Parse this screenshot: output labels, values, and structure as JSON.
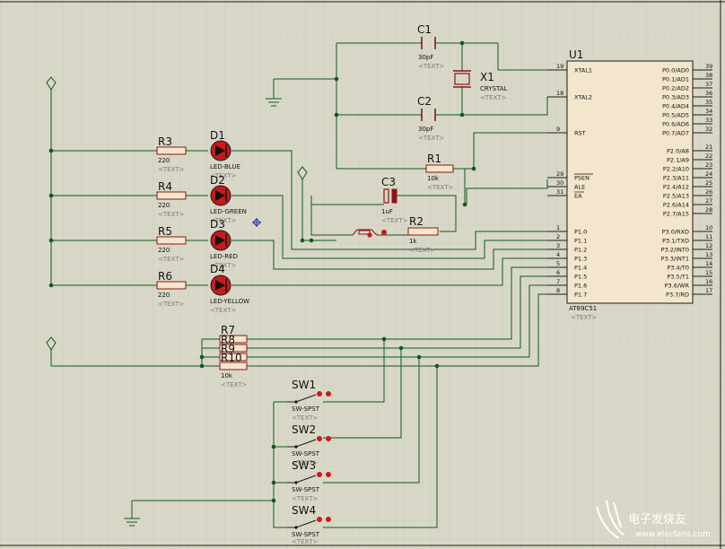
{
  "components": {
    "U1": {
      "ref": "U1",
      "part": "AT89C51",
      "text": "<TEXT>",
      "left_pins": [
        {
          "num": "19",
          "name": "XTAL1"
        },
        {
          "num": "18",
          "name": "XTAL2"
        },
        {
          "num": "9",
          "name": "RST"
        },
        {
          "num": "29",
          "name": "PSEN"
        },
        {
          "num": "30",
          "name": "ALE"
        },
        {
          "num": "31",
          "name": "EA"
        },
        {
          "num": "1",
          "name": "P1.0"
        },
        {
          "num": "2",
          "name": "P1.1"
        },
        {
          "num": "3",
          "name": "P1.2"
        },
        {
          "num": "4",
          "name": "P1.3"
        },
        {
          "num": "5",
          "name": "P1.4"
        },
        {
          "num": "6",
          "name": "P1.5"
        },
        {
          "num": "7",
          "name": "P1.6"
        },
        {
          "num": "8",
          "name": "P1.7"
        }
      ],
      "right_pins": [
        {
          "num": "39",
          "name": "P0.0/AD0"
        },
        {
          "num": "38",
          "name": "P0.1/AD1"
        },
        {
          "num": "37",
          "name": "P0.2/AD2"
        },
        {
          "num": "36",
          "name": "P0.3/AD3"
        },
        {
          "num": "35",
          "name": "P0.4/AD4"
        },
        {
          "num": "34",
          "name": "P0.5/AD5"
        },
        {
          "num": "33",
          "name": "P0.6/AD6"
        },
        {
          "num": "32",
          "name": "P0.7/AD7"
        },
        {
          "num": "21",
          "name": "P2.0/A8"
        },
        {
          "num": "22",
          "name": "P2.1/A9"
        },
        {
          "num": "23",
          "name": "P2.2/A10"
        },
        {
          "num": "24",
          "name": "P2.3/A11"
        },
        {
          "num": "25",
          "name": "P2.4/A12"
        },
        {
          "num": "26",
          "name": "P2.5/A13"
        },
        {
          "num": "27",
          "name": "P2.6/A14"
        },
        {
          "num": "28",
          "name": "P2.7/A15"
        },
        {
          "num": "10",
          "name": "P3.0/RXD"
        },
        {
          "num": "11",
          "name": "P3.1/TXD"
        },
        {
          "num": "12",
          "name": "P3.2/INT0"
        },
        {
          "num": "13",
          "name": "P3.3/INT1"
        },
        {
          "num": "14",
          "name": "P3.4/T0"
        },
        {
          "num": "15",
          "name": "P3.5/T1"
        },
        {
          "num": "16",
          "name": "P3.6/WR"
        },
        {
          "num": "17",
          "name": "P3.7/RD"
        }
      ]
    },
    "C1": {
      "ref": "C1",
      "value": "30pF",
      "text": "<TEXT>"
    },
    "C2": {
      "ref": "C2",
      "value": "30pF",
      "text": "<TEXT>"
    },
    "C3": {
      "ref": "C3",
      "value": "1uF",
      "text": "<TEXT>"
    },
    "X1": {
      "ref": "X1",
      "value": "CRYSTAL",
      "text": "<TEXT>"
    },
    "R1": {
      "ref": "R1",
      "value": "10k",
      "text": "<TEXT>"
    },
    "R2": {
      "ref": "R2",
      "value": "1k",
      "text": "<TEXT>"
    },
    "R3": {
      "ref": "R3",
      "value": "220",
      "text": "<TEXT>"
    },
    "R4": {
      "ref": "R4",
      "value": "220",
      "text": "<TEXT>"
    },
    "R5": {
      "ref": "R5",
      "value": "220",
      "text": "<TEXT>"
    },
    "R6": {
      "ref": "R6",
      "value": "220",
      "text": "<TEXT>"
    },
    "D1": {
      "ref": "D1",
      "value": "LED-BLUE",
      "text": "<TEXT>"
    },
    "D2": {
      "ref": "D2",
      "value": "LED-GREEN",
      "text": "<TEXT>"
    },
    "D3": {
      "ref": "D3",
      "value": "LED-RED",
      "text": "<TEXT>"
    },
    "D4": {
      "ref": "D4",
      "value": "LED-YELLOW",
      "text": "<TEXT>"
    },
    "RN": {
      "refs": [
        "R7",
        "R8",
        "R9",
        "R10"
      ],
      "value": "10k",
      "text": "<TEXT>"
    },
    "SW1": {
      "ref": "SW1",
      "value": "SW-SPST",
      "text": "<TEXT>"
    },
    "SW2": {
      "ref": "SW2",
      "value": "SW-SPST",
      "text": "<TEXT>"
    },
    "SW3": {
      "ref": "SW3",
      "value": "SW-SPST",
      "text": "<TEXT>"
    },
    "SW4": {
      "ref": "SW4",
      "value": "SW-SPST",
      "text": "<TEXT>"
    }
  },
  "watermark": {
    "line1": "电子发烧友",
    "line2": "www.elecfans.com"
  },
  "colors": {
    "background": "#d9d8c8",
    "grid": "#c6c5b2",
    "wire": "#0d5a1a",
    "component": "#8a1616",
    "chip_fill": "#f3e6cc",
    "led_fill": "#c81a1a",
    "placeholder_text": "#7b7b7b"
  }
}
